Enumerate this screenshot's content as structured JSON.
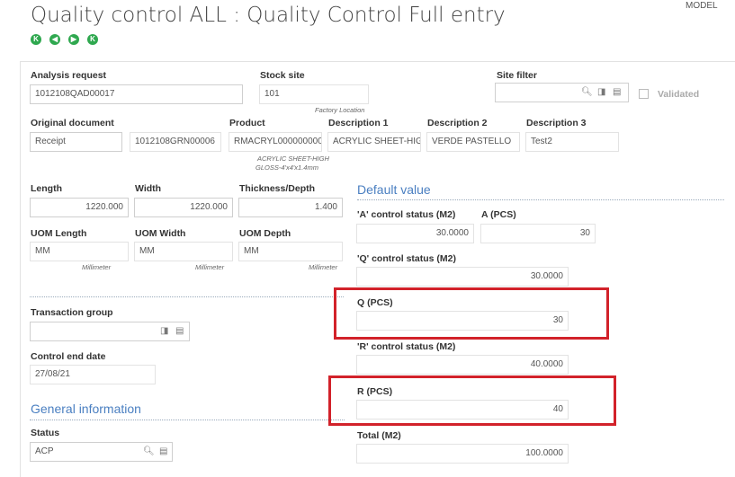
{
  "header": {
    "title": "Quality control ALL : Quality Control Full entry",
    "model": "MODEL"
  },
  "nav": {
    "first": "K",
    "prev": "◀",
    "next": "▶",
    "last": "K"
  },
  "fields": {
    "analysis_request": {
      "label": "Analysis request",
      "value": "1012108QAD00017"
    },
    "stock_site": {
      "label": "Stock site",
      "value": "101",
      "note": "Factory Location"
    },
    "site_filter": {
      "label": "Site filter",
      "value": ""
    },
    "validated": {
      "label": "Validated"
    },
    "original_document": {
      "label": "Original document",
      "value": "Receipt",
      "value2": "1012108GRN00006"
    },
    "product": {
      "label": "Product",
      "value": "RMACRYL000000000",
      "note1": "ACRYLIC SHEET-HIGH",
      "note2": "GLOSS-4'x4'x1.4mm"
    },
    "description1": {
      "label": "Description 1",
      "value": "ACRYLIC SHEET-HIG"
    },
    "description2": {
      "label": "Description 2",
      "value": "VERDE PASTELLO"
    },
    "description3": {
      "label": "Description 3",
      "value": "Test2"
    },
    "length": {
      "label": "Length",
      "value": "1220.000"
    },
    "width": {
      "label": "Width",
      "value": "1220.000"
    },
    "thickness": {
      "label": "Thickness/Depth",
      "value": "1.400"
    },
    "uom_length": {
      "label": "UOM Length",
      "value": "MM",
      "note": "Millimeter"
    },
    "uom_width": {
      "label": "UOM Width",
      "value": "MM",
      "note": "Millimeter"
    },
    "uom_depth": {
      "label": "UOM Depth",
      "value": "MM",
      "note": "Millimeter"
    },
    "transaction_group": {
      "label": "Transaction group",
      "value": ""
    },
    "control_end_date": {
      "label": "Control end date",
      "value": "27/08/21"
    },
    "status": {
      "label": "Status",
      "value": "ACP"
    }
  },
  "sections": {
    "default_value": "Default value",
    "general_information": "General information"
  },
  "default_value": {
    "a_m2": {
      "label": "'A' control status (M2)",
      "value": "30.0000"
    },
    "a_pcs": {
      "label": "A (PCS)",
      "value": "30"
    },
    "q_m2": {
      "label": "'Q' control status (M2)",
      "value": "30.0000"
    },
    "q_pcs": {
      "label": "Q (PCS)",
      "value": "30"
    },
    "r_m2": {
      "label": "'R' control status (M2)",
      "value": "40.0000"
    },
    "r_pcs": {
      "label": "R (PCS)",
      "value": "40"
    },
    "total_m2": {
      "label": "Total (M2)",
      "value": "100.0000"
    }
  },
  "colors": {
    "accent": "#4a7fc1",
    "nav_green": "#2fa84f",
    "highlight_red": "#d2222a"
  }
}
